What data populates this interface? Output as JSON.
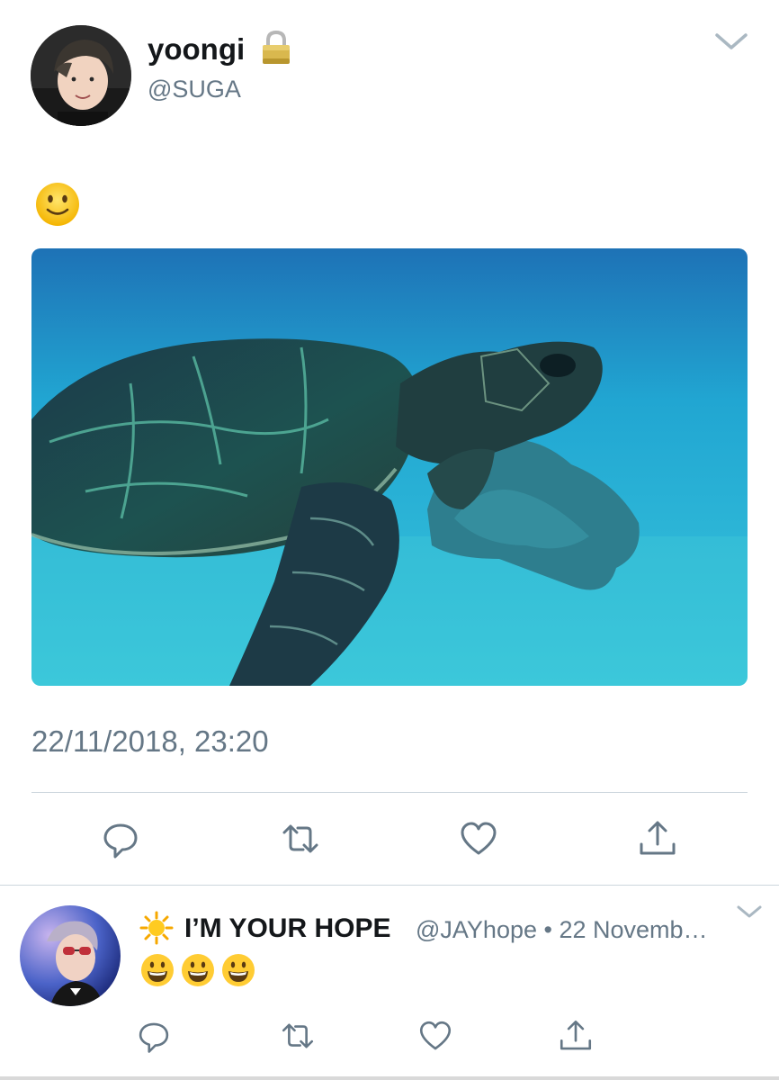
{
  "tweet": {
    "display_name": "yoongi",
    "handle": "@SUGA",
    "text_emoji_icon": "slightly-smiling-face-icon",
    "media_subject": "sea-turtle-photo",
    "timestamp": "22/11/2018, 23:20",
    "protected_icon": "lock-icon",
    "actions": [
      "reply-icon",
      "retweet-icon",
      "like-icon",
      "share-icon"
    ]
  },
  "reply": {
    "display_name": "I’M YOUR HOPE",
    "handle": "@JAYhope",
    "separator": "•",
    "date": "22 Novemb…",
    "name_prefix_icon": "sun-icon",
    "emoji_icons": [
      "grinning-face-icon",
      "grinning-face-icon",
      "grinning-face-icon"
    ],
    "actions": [
      "reply-icon",
      "retweet-icon",
      "like-icon",
      "share-icon"
    ]
  },
  "colors": {
    "text": "#14171a",
    "secondary": "#657786",
    "divider": "#ccd6dd",
    "ocean": "#1fa6cf"
  }
}
